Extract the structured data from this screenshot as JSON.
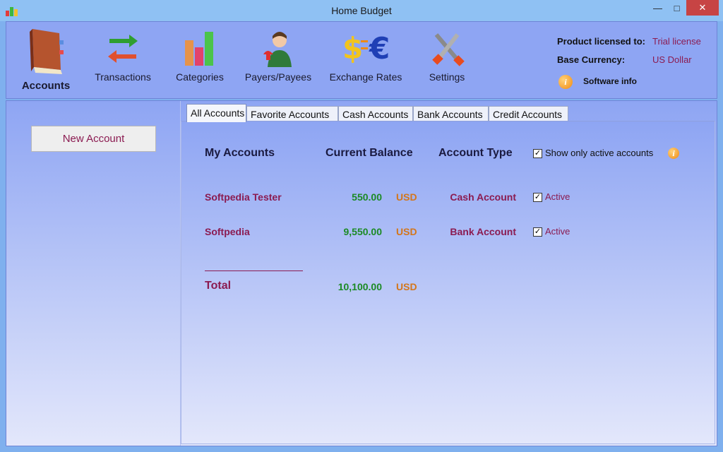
{
  "window": {
    "title": "Home Budget"
  },
  "toolbar": {
    "items": [
      {
        "label": "Accounts",
        "icon": "accounts-book-icon",
        "selected": true
      },
      {
        "label": "Transactions",
        "icon": "transactions-arrows-icon"
      },
      {
        "label": "Categories",
        "icon": "categories-chart-icon"
      },
      {
        "label": "Payers/Payees",
        "icon": "payers-person-icon"
      },
      {
        "label": "Exchange Rates",
        "icon": "exchange-currency-icon"
      },
      {
        "label": "Settings",
        "icon": "settings-tools-icon"
      }
    ]
  },
  "license": {
    "licensed_label": "Product licensed to:",
    "licensed_value": "Trial license",
    "currency_label": "Base Currency:",
    "currency_value": "US Dollar",
    "software_info": "Software info"
  },
  "sidebar": {
    "new_account": "New Account"
  },
  "tabs": [
    "All Accounts",
    "Favorite Accounts",
    "Cash Accounts",
    "Bank Accounts",
    "Credit Accounts"
  ],
  "accounts": {
    "headers": {
      "name": "My Accounts",
      "balance": "Current Balance",
      "type": "Account Type"
    },
    "show_active_label": "Show only active accounts",
    "show_active_checked": true,
    "rows": [
      {
        "name": "Softpedia Tester",
        "balance": "550.00",
        "currency": "USD",
        "type": "Cash Account",
        "active_label": "Active",
        "active": true
      },
      {
        "name": "Softpedia",
        "balance": "9,550.00",
        "currency": "USD",
        "type": "Bank Account",
        "active_label": "Active",
        "active": true
      }
    ],
    "total": {
      "label": "Total",
      "balance": "10,100.00",
      "currency": "USD"
    }
  },
  "colors": {
    "accent": "#8b1b51",
    "positive": "#1b8a24",
    "currency": "#d3761b",
    "toolbar": "#8ea5f3"
  }
}
